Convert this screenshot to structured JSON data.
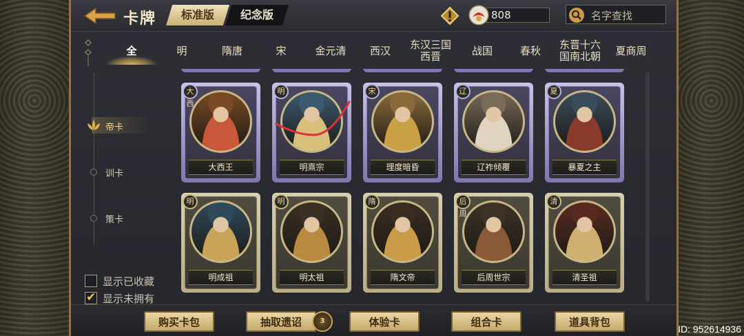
{
  "header": {
    "title": "卡牌",
    "version_tabs": [
      {
        "label": "标准版",
        "active": true
      },
      {
        "label": "纪念版",
        "active": false
      }
    ],
    "currency_amount": "808",
    "search_placeholder": "名字查找"
  },
  "dynasty_tabs": [
    {
      "label": "全",
      "active": true
    },
    {
      "label": "明"
    },
    {
      "label": "隋唐"
    },
    {
      "label": "宋"
    },
    {
      "label": "金元清"
    },
    {
      "label": "西汉"
    },
    {
      "label": "东汉三国\n西晋"
    },
    {
      "label": "战国"
    },
    {
      "label": "春秋"
    },
    {
      "label": "东晋十六\n国南北朝"
    },
    {
      "label": "夏商周"
    }
  ],
  "categories": [
    {
      "label": "帝卡",
      "active": true
    },
    {
      "label": "训卡"
    },
    {
      "label": "策卡"
    }
  ],
  "filters": [
    {
      "label": "显示已收藏",
      "checked": false
    },
    {
      "label": "显示未拥有",
      "checked": true
    }
  ],
  "cards": [
    {
      "name": "大西王",
      "dynasty": "大西",
      "frame": "purple",
      "colors": [
        "#7a4a24",
        "#c9573a"
      ]
    },
    {
      "name": "明熹宗",
      "dynasty": "明",
      "frame": "purple",
      "colors": [
        "#3b5a70",
        "#d8c07a"
      ]
    },
    {
      "name": "理度暗昏",
      "dynasty": "宋",
      "frame": "purple",
      "colors": [
        "#8a6a3a",
        "#c9a045"
      ]
    },
    {
      "name": "辽祚倾覆",
      "dynasty": "辽",
      "frame": "purple",
      "colors": [
        "#7a6a58",
        "#e0d4c0"
      ]
    },
    {
      "name": "暴夏之主",
      "dynasty": "夏",
      "frame": "purple",
      "colors": [
        "#3a4c5c",
        "#8a3a2a"
      ]
    },
    {
      "name": "明成祖",
      "dynasty": "明",
      "frame": "gold",
      "colors": [
        "#2f4a5a",
        "#c9a458"
      ]
    },
    {
      "name": "明太祖",
      "dynasty": "明",
      "frame": "gold",
      "colors": [
        "#3a3024",
        "#b88a40"
      ]
    },
    {
      "name": "隋文帝",
      "dynasty": "隋",
      "frame": "gold",
      "colors": [
        "#3a2e22",
        "#c99a48"
      ]
    },
    {
      "name": "后周世宗",
      "dynasty": "后周",
      "frame": "gold",
      "colors": [
        "#3d3226",
        "#8a5a38"
      ]
    },
    {
      "name": "清圣祖",
      "dynasty": "清",
      "frame": "gold",
      "colors": [
        "#5a2a22",
        "#d0b070"
      ]
    }
  ],
  "bottom_buttons": [
    {
      "label": "购买卡包"
    },
    {
      "label": "抽取遗诏",
      "badge": "3"
    },
    {
      "label": "体验卡"
    },
    {
      "label": "组合卡"
    },
    {
      "label": "道具背包"
    }
  ],
  "watermark": "ID: 952614936",
  "colors": {
    "accent_gold": "#d9b45c",
    "rare_frame": "#9f97cc",
    "common_frame": "#c8bc94"
  },
  "annotation": {
    "type": "red-scribble",
    "color": "#d8343a"
  }
}
